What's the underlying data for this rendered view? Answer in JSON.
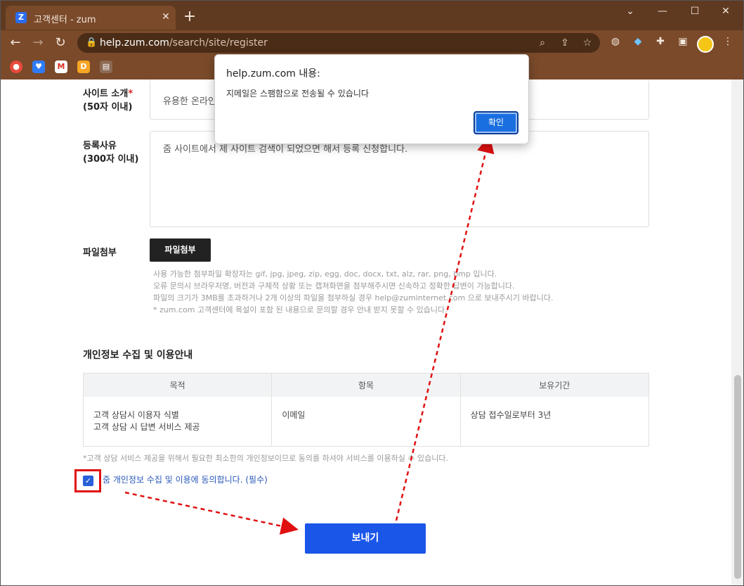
{
  "browser": {
    "tab_title": "고객센터 - zum",
    "tab_favicon": "Z",
    "url_host": "help.zum.com",
    "url_path": "/search/site/register"
  },
  "form": {
    "site_intro_label": "사이트 소개",
    "site_intro_required": "*",
    "site_intro_limit": "(50자 이내)",
    "site_intro_value": "유용한 온라인",
    "reason_label": "등록사유",
    "reason_limit": "(300자 이내)",
    "reason_value": "줌 사이트에서 제 사이트 검색이 되었으면 해서 등록 신청합니다.",
    "attach_label": "파일첨부",
    "attach_button": "파일첨부",
    "notes": [
      "사용 가능한 첨부파일 확장자는 gif, jpg, jpeg, zip, egg, doc, docx, txt, alz, rar, png, bmp 입니다.",
      "오류 문의시 브라우저명, 버전과 구체적 상황 또는 캡쳐화면을 첨부해주시면 신속하고 정확한 답변이 가능합니다.",
      "파일의 크기가 3MB를 초과하거나 2개 이상의 파일을 첨부하실 경우 help@zuminternet.com 으로 보내주시기 바랍니다.",
      " * zum.com 고객센터에 욕설이 포함 된 내용으로 문의할 경우 안내 받지 못할 수 있습니다."
    ]
  },
  "privacy": {
    "title": "개인정보 수집 및 이용안내",
    "headers": [
      "목적",
      "항목",
      "보유기간"
    ],
    "purpose_lines": [
      "고객 상담시 이용자 식별",
      "고객 상담 시 답변 서비스 제공"
    ],
    "item": "이메일",
    "period": "상담 접수일로부터 3년",
    "note": "*고객 상담 서비스 제공을 위해서 필요한 최소한의 개인정보이므로 동의를 하셔야 서비스를 이용하실 수 있습니다.",
    "agree_text": "줌 개인정보 수집 및 이용에 동의합니다. (필수)",
    "agree_checked": true
  },
  "submit_label": "보내기",
  "dialog": {
    "title": "help.zum.com 내용:",
    "message": "지메일은 스팸함으로 전송될 수 있습니다",
    "ok_label": "확인"
  },
  "colors": {
    "chrome": "#5f3a21",
    "accent": "#1a56e8",
    "annotation": "#e01010"
  }
}
